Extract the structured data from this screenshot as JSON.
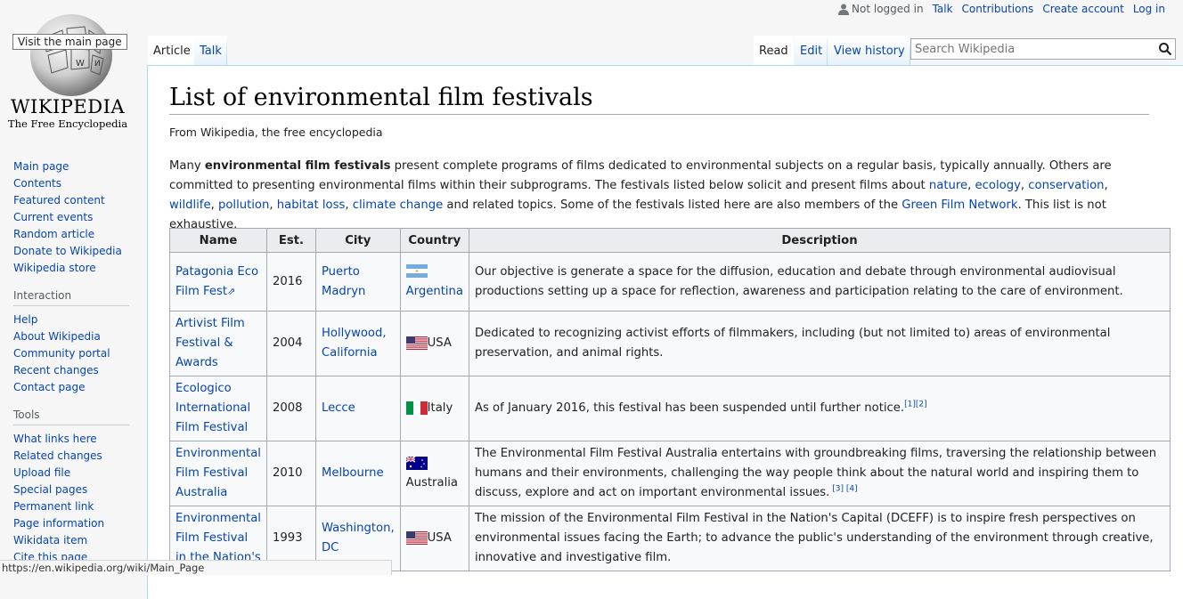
{
  "logo": {
    "tooltip": "Visit the main page",
    "wordmark": "WIKIPEDIA",
    "tagline": "The Free Encyclopedia"
  },
  "sidebar": {
    "navigation": [
      "Main page",
      "Contents",
      "Featured content",
      "Current events",
      "Random article",
      "Donate to Wikipedia",
      "Wikipedia store"
    ],
    "interaction_title": "Interaction",
    "interaction": [
      "Help",
      "About Wikipedia",
      "Community portal",
      "Recent changes",
      "Contact page"
    ],
    "tools_title": "Tools",
    "tools": [
      "What links here",
      "Related changes",
      "Upload file",
      "Special pages",
      "Permanent link",
      "Page information",
      "Wikidata item",
      "Cite this page"
    ]
  },
  "personal": {
    "not_logged_in": "Not logged in",
    "talk": "Talk",
    "contributions": "Contributions",
    "create_account": "Create account",
    "log_in": "Log in"
  },
  "tabs": {
    "article": "Article",
    "talk": "Talk",
    "read": "Read",
    "edit": "Edit",
    "history": "View history"
  },
  "search": {
    "placeholder": "Search Wikipedia"
  },
  "article": {
    "title": "List of environmental film festivals",
    "subtitle": "From Wikipedia, the free encyclopedia",
    "intro": {
      "p1": "Many ",
      "bold": "environmental film festivals",
      "p2": " present complete programs of films dedicated to environmental subjects on a regular basis, typically annually. Others are committed to presenting environmental films within their subprograms. The festivals listed below solicit and present films about ",
      "links": [
        "nature",
        "ecology",
        "conservation",
        "wildlife",
        "pollution",
        "habitat loss",
        "climate change"
      ],
      "p3": " and related topics. Some of the festivals listed here are also members of the ",
      "gfn": "Green Film Network",
      "p4": ". This list is not exhaustive."
    }
  },
  "table": {
    "headers": [
      "Name",
      "Est.",
      "City",
      "Country",
      "Description"
    ],
    "rows": [
      {
        "name": "Patagonia Eco Film Fest",
        "est": "2016",
        "city": "Puerto Madryn",
        "country": "Argentina",
        "flag": "argentina",
        "desc": "Our objective is generate a space for the diffusion, education and debate through environmental audiovisual productions setting up a space for reflection, awareness and participation relating to the care of environment.",
        "refs": ""
      },
      {
        "name": "Artivist Film Festival & Awards",
        "est": "2004",
        "city": "Hollywood, California",
        "country": "USA",
        "flag": "usa",
        "desc": "Dedicated to recognizing activist efforts of filmmakers, including (but not limited to) areas of environmental preservation, and animal rights.",
        "refs": ""
      },
      {
        "name": "Ecologico International Film Festival",
        "est": "2008",
        "city": "Lecce",
        "country": "Italy",
        "flag": "italy",
        "desc": "As of January 2016, this festival has been suspended until further notice.",
        "refs": "[1][2]"
      },
      {
        "name": "Environmental Film Festival Australia",
        "est": "2010",
        "city": "Melbourne",
        "country": "Australia",
        "flag": "australia",
        "desc": "The Environmental Film Festival Australia entertains with groundbreaking films, traversing the relationship between humans and their environments, challenging the way people think about the natural world and inspiring them to discuss, explore and act on important environmental issues.",
        "refs": " [3] [4]"
      },
      {
        "name": "Environmental Film Festival in the Nation's",
        "est": "1993",
        "city": "Washington, DC",
        "country": "USA",
        "flag": "usa",
        "desc": "The mission of the Environmental Film Festival in the Nation's Capital (DCEFF) is to inspire fresh perspectives on environmental issues facing the Earth; to advance the public's understanding of the environment through creative, innovative and investigative film.",
        "refs": ""
      }
    ]
  },
  "statusbar": {
    "url": "https://en.wikipedia.org/wiki/Main_Page"
  }
}
